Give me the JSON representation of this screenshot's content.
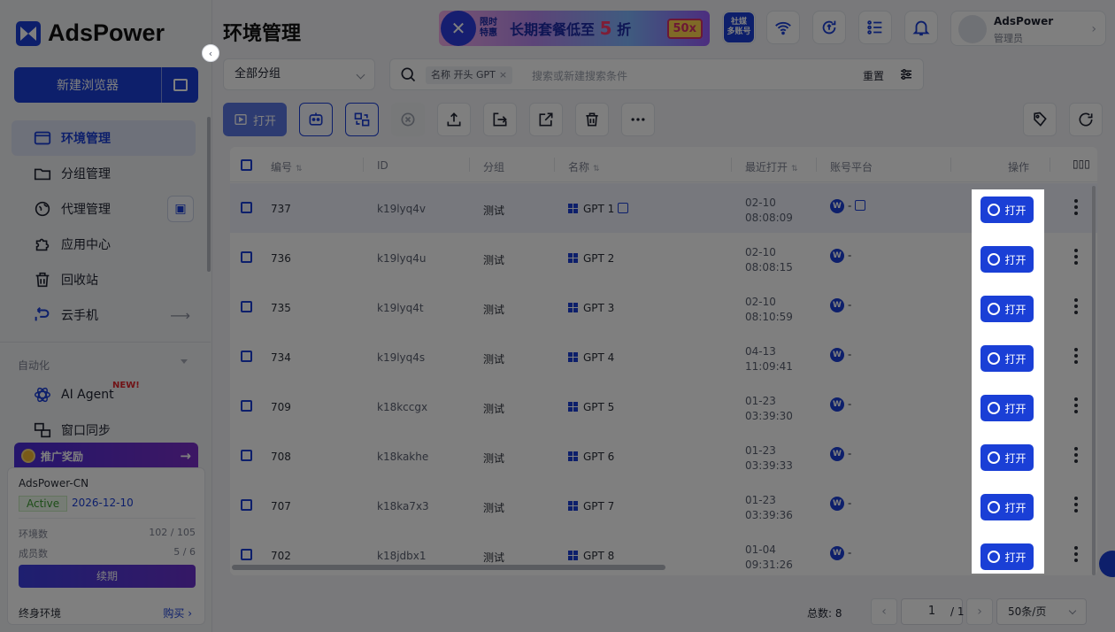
{
  "app": {
    "name": "AdsPower"
  },
  "sidebar": {
    "new_browser": "新建浏览器",
    "items": [
      {
        "label": "环境管理",
        "icon": "profile-window-icon",
        "active": true
      },
      {
        "label": "分组管理",
        "icon": "folder-icon"
      },
      {
        "label": "代理管理",
        "icon": "globe-icon"
      },
      {
        "label": "应用中心",
        "icon": "puzzle-icon"
      },
      {
        "label": "回收站",
        "icon": "trash-icon"
      },
      {
        "label": "云手机",
        "icon": "cloud-phone-icon"
      }
    ],
    "automation_header": "自动化",
    "automation_items": [
      {
        "label": "AI Agent",
        "badge": "NEW!",
        "icon": "atom-icon"
      },
      {
        "label": "窗口同步",
        "icon": "window-sync-icon"
      }
    ],
    "promo": {
      "label": "推广奖励"
    },
    "account": {
      "company": "AdsPower-CN",
      "status": "Active",
      "expiry": "2026-12-10",
      "env_label": "环境数",
      "env_value": "102 / 105",
      "member_label": "成员数",
      "member_value": "5 / 6",
      "renew": "续期",
      "lifetime": "终身环境",
      "buy": "购买"
    }
  },
  "header": {
    "title": "环境管理",
    "banner": {
      "tag_line1": "限时",
      "tag_line2": "特惠",
      "text": "长期套餐低至",
      "number": "5",
      "suffix": "折",
      "badge": "50x"
    },
    "matrix_btn": {
      "line1": "社媒",
      "line2": "多账号"
    },
    "user": {
      "name": "AdsPower",
      "role": "管理员"
    }
  },
  "filters": {
    "group": "全部分组",
    "chip": "名称 开头 GPT",
    "chip_close": "×",
    "placeholder": "搜索或新建搜索条件",
    "reset": "重置"
  },
  "toolbar": {
    "open": "打开"
  },
  "table": {
    "columns": {
      "num": "编号",
      "id": "ID",
      "group": "分组",
      "name": "名称",
      "last_open": "最近打开",
      "platform": "账号平台",
      "action": "操作"
    },
    "open_btn": "打开",
    "rows": [
      {
        "num": "737",
        "id": "k19lyq4v",
        "group": "测试",
        "name": "GPT 1",
        "date": "02-10",
        "time": "08:08:09",
        "platform": "-"
      },
      {
        "num": "736",
        "id": "k19lyq4u",
        "group": "测试",
        "name": "GPT 2",
        "date": "02-10",
        "time": "08:08:15",
        "platform": "-"
      },
      {
        "num": "735",
        "id": "k19lyq4t",
        "group": "测试",
        "name": "GPT 3",
        "date": "02-10",
        "time": "08:10:59",
        "platform": "-"
      },
      {
        "num": "734",
        "id": "k19lyq4s",
        "group": "测试",
        "name": "GPT 4",
        "date": "04-13",
        "time": "11:09:41",
        "platform": "-"
      },
      {
        "num": "709",
        "id": "k18kccgx",
        "group": "测试",
        "name": "GPT 5",
        "date": "01-23",
        "time": "03:39:30",
        "platform": "-"
      },
      {
        "num": "708",
        "id": "k18kakhe",
        "group": "测试",
        "name": "GPT 6",
        "date": "01-23",
        "time": "03:39:33",
        "platform": "-"
      },
      {
        "num": "707",
        "id": "k18ka7x3",
        "group": "测试",
        "name": "GPT 7",
        "date": "01-23",
        "time": "03:39:36",
        "platform": "-"
      },
      {
        "num": "702",
        "id": "k18jdbx1",
        "group": "测试",
        "name": "GPT 8",
        "date": "01-04",
        "time": "09:31:26",
        "platform": "-"
      }
    ]
  },
  "pagination": {
    "total": "总数: 8",
    "page": "1",
    "pages": "/ 1",
    "page_size": "50条/页"
  },
  "colors": {
    "brand": "#1a3fd6",
    "overlay": "rgba(0,0,0,0.5)"
  }
}
